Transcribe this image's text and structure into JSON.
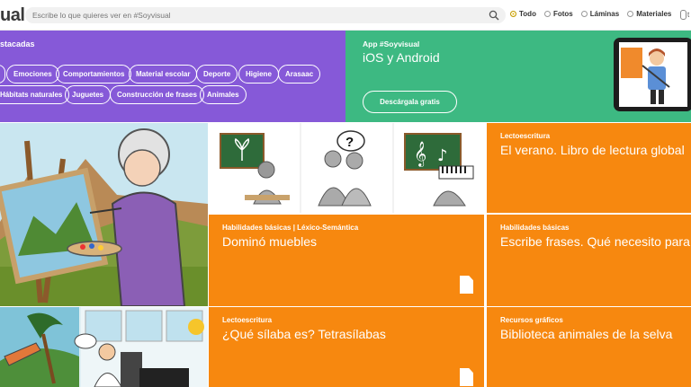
{
  "header": {
    "logo_text": "ual",
    "search_placeholder": "Escribe lo que quieres ver en #Soyvisual",
    "filters": [
      {
        "label": "Todo",
        "selected": true
      },
      {
        "label": "Fotos",
        "selected": false
      },
      {
        "label": "Láminas",
        "selected": false
      },
      {
        "label": "Materiales",
        "selected": false
      }
    ],
    "extra_text": "t"
  },
  "destacadas": {
    "title": "stacadas",
    "tags_row1": [
      "",
      "Emociones",
      "Comportamientos",
      "Material escolar",
      "Deporte",
      "Higiene",
      "Arasaac"
    ],
    "tags_row2": [
      "Hábitats naturales",
      "Juguetes",
      "Construcción de frases",
      "Animales"
    ]
  },
  "app_promo": {
    "label": "App #Soyvisual",
    "title": "iOS y Android",
    "button": "Descárgala gratis"
  },
  "tiles": [
    {
      "category": "Lectoescritura",
      "title": "El verano. Libro de lectura global"
    },
    {
      "category": "Habilidades básicas | Léxico-Semántica",
      "title": "Dominó muebles"
    },
    {
      "category": "Habilidades básicas",
      "title": "Escribe frases. Qué necesito para"
    },
    {
      "category": "Lectoescritura",
      "title": "¿Qué sílaba es? Tetrasílabas"
    },
    {
      "category": "Recursos gráficos",
      "title": "Biblioteca animales de la selva"
    }
  ],
  "colors": {
    "purple": "#8659d8",
    "green": "#3db982",
    "orange": "#f7880f"
  }
}
